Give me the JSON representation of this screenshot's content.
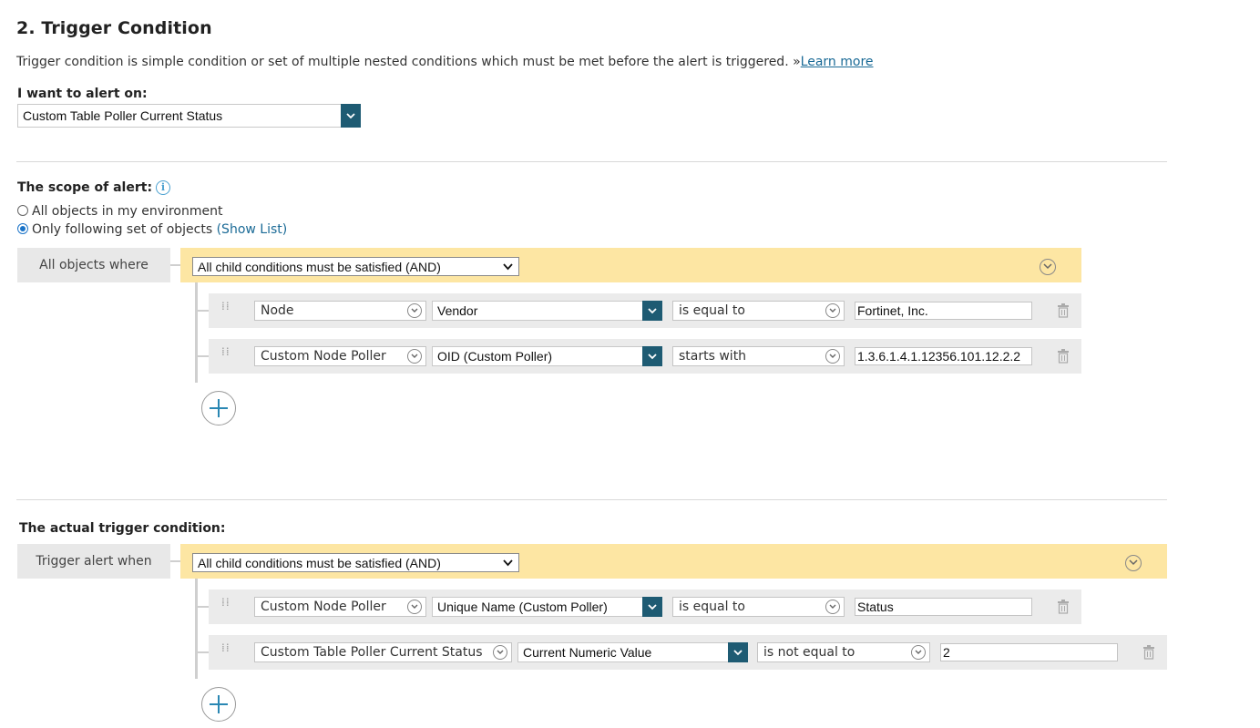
{
  "section": {
    "title": "2. Trigger Condition",
    "description": "Trigger condition is simple condition or set of multiple nested conditions which must be met before the alert is triggered. »",
    "learn_more": "Learn more"
  },
  "alert_on": {
    "label": "I want to alert on:",
    "value": "Custom Table Poller Current Status"
  },
  "scope": {
    "label": "The scope of alert:",
    "options": [
      {
        "label": "All objects in my environment",
        "selected": false
      },
      {
        "label": "Only following set of objects",
        "selected": true
      }
    ],
    "show_list": "(Show List)",
    "where_label": "All objects where",
    "group_operator": "All child conditions must be satisfied (AND)",
    "conditions": [
      {
        "object": "Node",
        "field": "Vendor",
        "operator": "is equal to",
        "value": "Fortinet, Inc."
      },
      {
        "object": "Custom Node Poller",
        "field": "OID (Custom Poller)",
        "operator": "starts with",
        "value": "1.3.6.1.4.1.12356.101.12.2.2"
      }
    ]
  },
  "trigger": {
    "label": "The actual trigger condition:",
    "where_label": "Trigger alert when",
    "group_operator": "All child conditions must be satisfied (AND)",
    "conditions": [
      {
        "object": "Custom Node Poller",
        "field": "Unique Name (Custom Poller)",
        "operator": "is equal to",
        "value": "Status"
      },
      {
        "object": "Custom Table Poller Current Status",
        "field": "Current Numeric Value",
        "operator": "is not equal to",
        "value": "2"
      }
    ]
  },
  "colors": {
    "accent_dark": "#1e5b73",
    "and_bar": "#fde6a3",
    "link": "#1a6a96"
  },
  "icons": [
    "chevron-down-icon",
    "info-icon",
    "drag-handle-icon",
    "trash-icon",
    "add-condition-icon"
  ]
}
